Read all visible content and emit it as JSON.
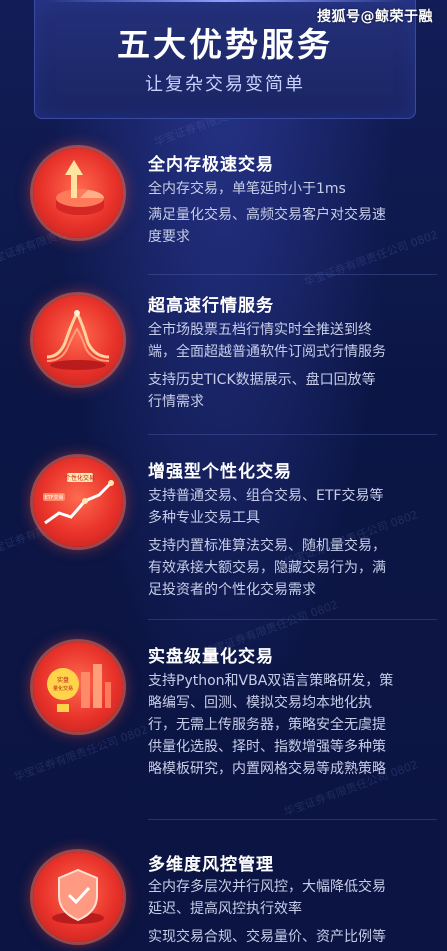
{
  "watermark_top": "搜狐号@鲸荣于融",
  "header": {
    "title": "五大优势服务",
    "subtitle": "让复杂交易变简单"
  },
  "features": [
    {
      "title": "全内存极速交易",
      "icon": "arrow-up-pie-icon",
      "lines": [
        "全内存交易，单笔延时小于1ms",
        "满足量化交易、高频交易客户对交易速",
        "度要求"
      ]
    },
    {
      "title": "超高速行情服务",
      "icon": "wave-chart-icon",
      "lines": [
        "全市场股票五档行情实时全推送到终",
        "端，全面超越普通软件订阅式行情服务",
        "支持历史TICK数据展示、盘口回放等",
        "行情需求"
      ]
    },
    {
      "title": "增强型个性化交易",
      "icon": "trend-line-icon",
      "icon_labels": [
        "个性化交易",
        "ETF交易"
      ],
      "lines": [
        "支持普通交易、组合交易、ETF交易等",
        "多种专业交易工具",
        "支持内置标准算法交易、随机量交易，",
        "有效承接大额交易，隐藏交易行为，满",
        "足投资者的个性化交易需求"
      ]
    },
    {
      "title": "实盘级量化交易",
      "icon": "bar-chart-icon",
      "icon_labels": [
        "实盘",
        "量化交易"
      ],
      "lines": [
        "支持Python和VBA双语言策略研发，策",
        "略编写、回测、模拟交易均本地化执",
        "行，无需上传服务器，策略安全无虞提",
        "供量化选股、择时、指数增强等多种策",
        "略模板研究，内置网格交易等成熟策略"
      ]
    },
    {
      "title": "多维度风控管理",
      "icon": "shield-icon",
      "lines": [
        "全内存多层次并行风控，大幅降低交易",
        "延迟、提高风控执行效率",
        "实现交易合规、交易量价、资产比例等"
      ]
    }
  ],
  "watermark_text": "华宝证券有限责任公司 0802",
  "colors": {
    "background": "#0d1748",
    "icon_red": "#e8322a",
    "title_white": "#ffffff",
    "body_text": "#c7cde8"
  }
}
